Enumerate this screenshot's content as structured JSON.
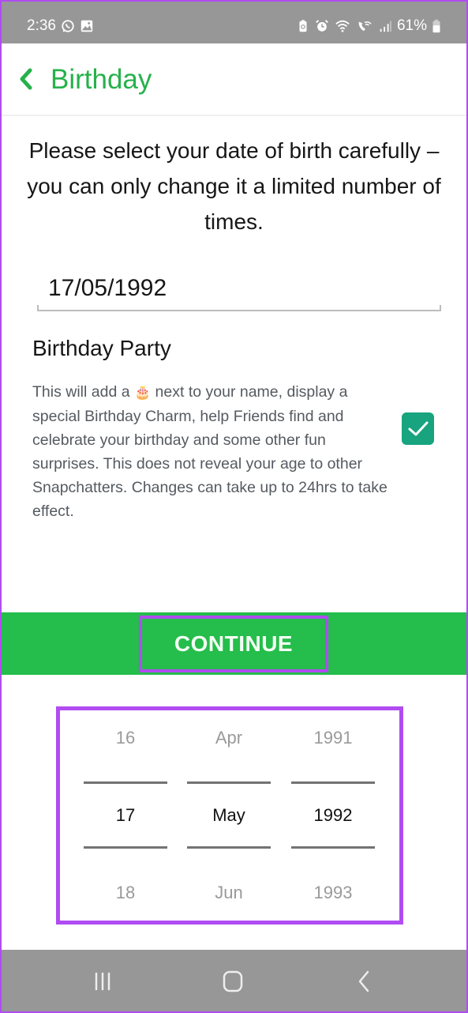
{
  "status_bar": {
    "time": "2:36",
    "left_icons": [
      "whatsapp-icon",
      "gallery-icon"
    ],
    "right_icons": [
      "battery-saver-icon",
      "alarm-icon",
      "wifi-icon",
      "wifi-calling-icon",
      "signal-icon"
    ],
    "battery": "61%"
  },
  "header": {
    "back_icon": "chevron-left-icon",
    "title": "Birthday"
  },
  "intro_text": "Please select your date of birth carefully – you can only change it a limited number of times.",
  "date_field": {
    "value": "17/05/1992"
  },
  "birthday_party": {
    "title": "Birthday Party",
    "description_before_icon": "This will add a ",
    "icon": "🎂",
    "description_after_icon": " next to your name, display a special Birthday Charm, help Friends find and celebrate your birthday and some other fun surprises. This does not reveal your age to other Snapchatters. Changes can take up to 24hrs to take effect.",
    "checked": true
  },
  "continue_label": "CONTINUE",
  "picker": {
    "day": {
      "prev": "16",
      "selected": "17",
      "next": "18"
    },
    "month": {
      "prev": "Apr",
      "selected": "May",
      "next": "Jun"
    },
    "year": {
      "prev": "1991",
      "selected": "1992",
      "next": "1993"
    }
  },
  "nav_bar": {
    "buttons": [
      "recent-apps-icon",
      "home-icon",
      "back-icon"
    ]
  },
  "colors": {
    "brand_green": "#25bd4b",
    "title_green": "#26b14b",
    "checkbox_teal": "#17a47f",
    "highlight_purple": "#b04cf2",
    "system_bar_gray": "#979797"
  }
}
